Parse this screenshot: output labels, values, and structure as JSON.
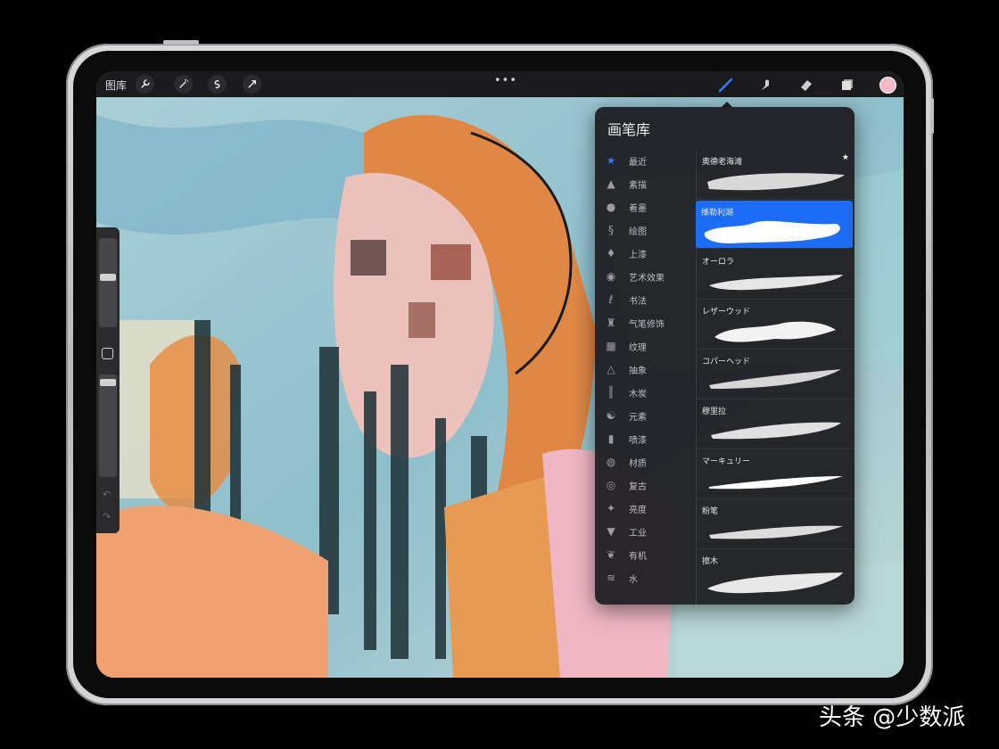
{
  "topbar": {
    "gallery_label": "图库",
    "more_dots": "•••",
    "left_tools": [
      "wrench-icon",
      "magic-wand-icon",
      "selection-icon",
      "transform-arrow-icon"
    ],
    "right_tools": [
      "brush-icon",
      "smudge-icon",
      "eraser-icon",
      "layers-icon"
    ],
    "color_swatch": "#f2b9c7",
    "accent": "#2f7cff"
  },
  "sidebar": {
    "items": [
      "brush-size-slider",
      "modify-button",
      "opacity-slider",
      "undo-icon",
      "redo-icon"
    ]
  },
  "brush_library": {
    "title": "画笔库",
    "categories": [
      {
        "label": "最近",
        "icon": "star-icon",
        "active": true
      },
      {
        "label": "素描",
        "icon": "pencil-tip-icon"
      },
      {
        "label": "着墨",
        "icon": "ink-drop-icon"
      },
      {
        "label": "绘图",
        "icon": "drawing-curve-icon"
      },
      {
        "label": "上漆",
        "icon": "paint-brush-icon"
      },
      {
        "label": "艺术效果",
        "icon": "palette-icon"
      },
      {
        "label": "书法",
        "icon": "calligraphy-icon"
      },
      {
        "label": "气笔修饰",
        "icon": "airbrush-icon"
      },
      {
        "label": "纹理",
        "icon": "texture-icon"
      },
      {
        "label": "抽象",
        "icon": "triangle-icon"
      },
      {
        "label": "木炭",
        "icon": "charcoal-icon"
      },
      {
        "label": "元素",
        "icon": "yin-yang-icon"
      },
      {
        "label": "喷漆",
        "icon": "spray-can-icon"
      },
      {
        "label": "材质",
        "icon": "material-icon"
      },
      {
        "label": "复古",
        "icon": "retro-icon"
      },
      {
        "label": "亮度",
        "icon": "sparkle-icon"
      },
      {
        "label": "工业",
        "icon": "anvil-icon"
      },
      {
        "label": "有机",
        "icon": "leaf-icon"
      },
      {
        "label": "水",
        "icon": "waves-icon"
      }
    ],
    "brushes": [
      {
        "name": "奥德老海滩",
        "starred": true
      },
      {
        "name": "维勒利湖",
        "selected": true
      },
      {
        "name": "オーロラ"
      },
      {
        "name": "レザーウッド"
      },
      {
        "name": "コパーヘッド"
      },
      {
        "name": "穆里拉"
      },
      {
        "name": "マーキュリー"
      },
      {
        "name": "粉笔"
      },
      {
        "name": "擦木"
      }
    ],
    "star_glyph": "★"
  },
  "watermark": "头条 @少数派"
}
